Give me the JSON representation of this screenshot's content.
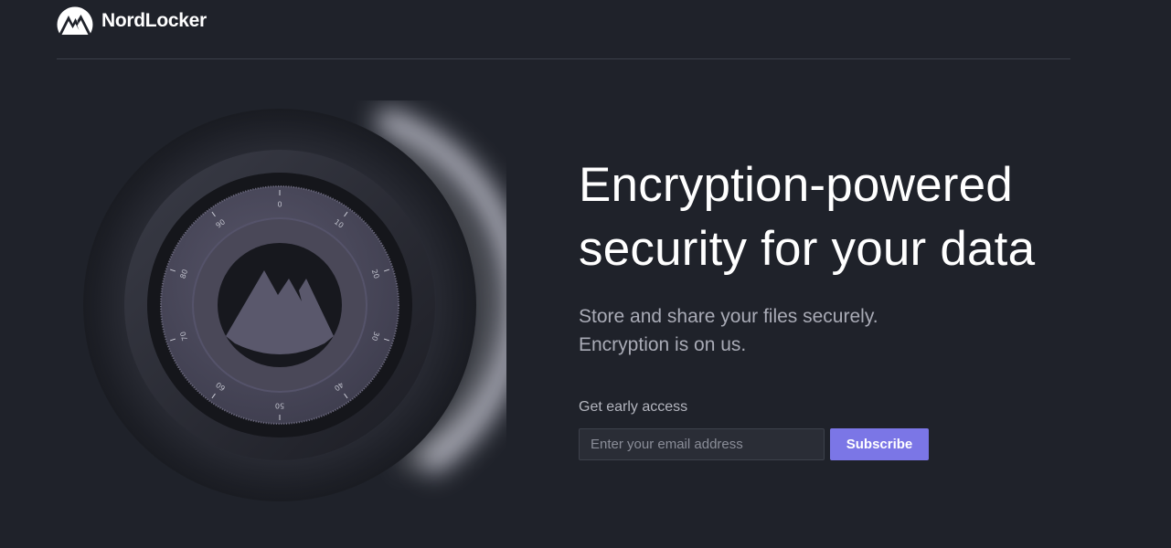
{
  "brand": {
    "name": "NordLocker",
    "logo_icon": "mountain-logo-icon"
  },
  "hero": {
    "title_lines": [
      "Encryption-powered",
      "security for your data"
    ],
    "subtitle_lines": [
      "Store and share your files securely.",
      "Encryption is on us."
    ]
  },
  "signup": {
    "label": "Get early access",
    "email_placeholder": "Enter your email address",
    "email_value": "",
    "subscribe_label": "Subscribe"
  },
  "dial": {
    "tick_labels": [
      "0",
      "10",
      "20",
      "30",
      "40",
      "50",
      "60",
      "70",
      "80",
      "90"
    ]
  },
  "colors": {
    "background": "#1f222a",
    "accent": "#7b76e6",
    "divider": "#3b3f4a",
    "subtitle": "#a9abb6"
  }
}
